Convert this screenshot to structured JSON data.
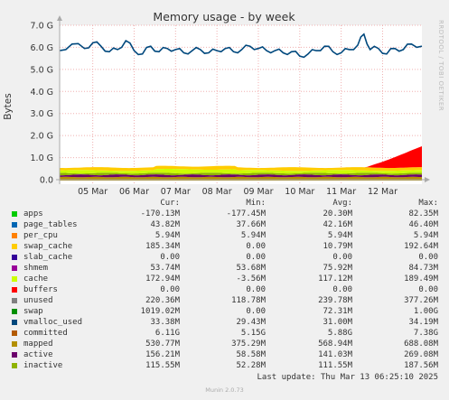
{
  "chart_data": {
    "type": "area",
    "title": "Memory usage - by week",
    "ylabel": "Bytes",
    "side_label": "RRDTOOL / TOBI OETIKER",
    "ylim": [
      0,
      7.0
    ],
    "y_unit": "G",
    "yticks": [
      "0.0",
      "1.0 G",
      "2.0 G",
      "3.0 G",
      "4.0 G",
      "5.0 G",
      "6.0 G",
      "7.0 G"
    ],
    "xticks": [
      "05 Mar",
      "06 Mar",
      "07 Mar",
      "08 Mar",
      "09 Mar",
      "10 Mar",
      "11 Mar",
      "12 Mar"
    ],
    "xrange_days": [
      4.2,
      12.95
    ],
    "grid": true,
    "committed": {
      "x": [
        4.2,
        4.5,
        4.8,
        5.0,
        5.2,
        5.4,
        5.6,
        5.8,
        6.0,
        6.2,
        6.4,
        6.6,
        6.8,
        7.0,
        7.2,
        7.4,
        7.6,
        7.8,
        8.0,
        8.2,
        8.4,
        8.6,
        8.8,
        9.0,
        9.2,
        9.4,
        9.6,
        9.8,
        10.0,
        10.2,
        10.4,
        10.6,
        10.8,
        11.0,
        11.2,
        11.4,
        11.55,
        11.7,
        11.9,
        12.1,
        12.3,
        12.5,
        12.7,
        12.95
      ],
      "values": [
        5.85,
        6.15,
        5.95,
        6.2,
        6.05,
        5.8,
        5.9,
        6.3,
        5.85,
        5.7,
        6.05,
        5.8,
        5.95,
        5.9,
        5.75,
        5.85,
        5.9,
        5.75,
        5.85,
        5.95,
        5.8,
        5.9,
        6.05,
        5.95,
        5.85,
        5.85,
        5.75,
        5.8,
        5.6,
        5.7,
        5.85,
        6.05,
        5.8,
        5.75,
        5.9,
        6.1,
        6.6,
        5.9,
        5.95,
        5.7,
        5.95,
        5.9,
        6.15,
        6.05
      ]
    },
    "stack_note": "apps / mapped / active / inactive / unused / swap stacked near the bottom",
    "legend_headers": [
      "Cur:",
      "Min:",
      "Avg:",
      "Max:"
    ],
    "series": [
      {
        "name": "apps",
        "color": "#00cc00",
        "cur": "-170.13M",
        "min": "-177.45M",
        "avg": "20.30M",
        "max": "82.35M"
      },
      {
        "name": "page_tables",
        "color": "#0066b3",
        "cur": "43.82M",
        "min": "37.66M",
        "avg": "42.16M",
        "max": "46.40M"
      },
      {
        "name": "per_cpu",
        "color": "#ff8000",
        "cur": "5.94M",
        "min": "5.94M",
        "avg": "5.94M",
        "max": "5.94M"
      },
      {
        "name": "swap_cache",
        "color": "#ffcc00",
        "cur": "185.34M",
        "min": "0.00",
        "avg": "10.79M",
        "max": "192.64M"
      },
      {
        "name": "slab_cache",
        "color": "#330099",
        "cur": "0.00",
        "min": "0.00",
        "avg": "0.00",
        "max": "0.00"
      },
      {
        "name": "shmem",
        "color": "#990099",
        "cur": "53.74M",
        "min": "53.68M",
        "avg": "75.92M",
        "max": "84.73M"
      },
      {
        "name": "cache",
        "color": "#ccff00",
        "cur": "172.94M",
        "min": "-3.56M",
        "avg": "117.12M",
        "max": "189.49M"
      },
      {
        "name": "buffers",
        "color": "#ff0000",
        "cur": "0.00",
        "min": "0.00",
        "avg": "0.00",
        "max": "0.00"
      },
      {
        "name": "unused",
        "color": "#808080",
        "cur": "220.36M",
        "min": "118.78M",
        "avg": "239.78M",
        "max": "377.26M"
      },
      {
        "name": "swap",
        "color": "#008f00",
        "cur": "1019.02M",
        "min": "0.00",
        "avg": "72.31M",
        "max": "1.00G"
      },
      {
        "name": "vmalloc_used",
        "color": "#00487d",
        "cur": "33.38M",
        "min": "29.43M",
        "avg": "31.00M",
        "max": "34.19M"
      },
      {
        "name": "committed",
        "color": "#b35a00",
        "cur": "6.11G",
        "min": "5.15G",
        "avg": "5.88G",
        "max": "7.38G"
      },
      {
        "name": "mapped",
        "color": "#b38f00",
        "cur": "530.77M",
        "min": "375.29M",
        "avg": "568.94M",
        "max": "688.08M"
      },
      {
        "name": "active",
        "color": "#6b006b",
        "cur": "156.21M",
        "min": "58.58M",
        "avg": "141.03M",
        "max": "269.08M"
      },
      {
        "name": "inactive",
        "color": "#8fb300",
        "cur": "115.55M",
        "min": "52.28M",
        "avg": "111.55M",
        "max": "187.56M"
      }
    ]
  },
  "footer": {
    "last_update": "Last update: Thu Mar 13 06:25:10 2025",
    "munin": "Munin 2.0.73"
  }
}
